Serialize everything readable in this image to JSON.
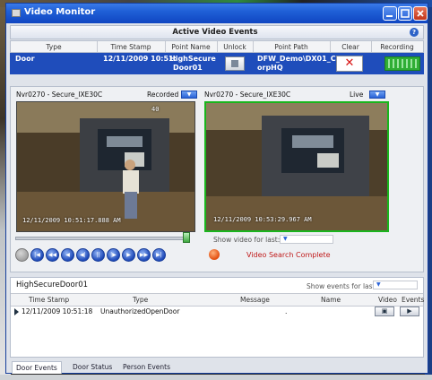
{
  "window": {
    "title": "Video Monitor"
  },
  "active_events": {
    "title": "Active Video Events",
    "columns": [
      "Type",
      "Time Stamp",
      "Point Name",
      "Unlock",
      "Point Path",
      "Clear",
      "Recording"
    ],
    "row": {
      "type": "Door",
      "time_stamp": "12/11/2009 10:51:",
      "point_name_1": "HighSecure",
      "point_name_2": "Door01",
      "point_path_1": "DFW_Demo\\DX01_C",
      "point_path_2": "orpHQ",
      "clear_glyph": "✕"
    }
  },
  "cameras": {
    "left": {
      "name": "Nvr0270 - Secure_IXE30C",
      "mode": "Recorded",
      "timestamp": "12/11/2009  10:51:17.888 AM",
      "frame_counter": "40"
    },
    "right": {
      "name": "Nvr0270 - Secure_IXE30C",
      "mode": "Live",
      "timestamp": "12/11/2009  10:53:29.967 AM"
    }
  },
  "playback": {
    "show_video_label": "Show video for last:",
    "status": "Video Search Complete",
    "position_fraction": 0.97
  },
  "events": {
    "title": "HighSecureDoor01",
    "show_events_label": "Show events for last:",
    "columns": [
      "Time Stamp",
      "Type",
      "Message",
      "Name",
      "Video",
      "Events"
    ],
    "rows": [
      {
        "time_stamp": "12/11/2009 10:51:18",
        "type": "UnauthorizedOpenDoor",
        "message": "",
        "name": "."
      }
    ]
  },
  "tabs": [
    "Door Events",
    "Door Status",
    "Person Events"
  ],
  "colors": {
    "title_bar": "#1f5fd6",
    "selected_row": "#1f4dbb",
    "recording": "#2fae34",
    "live_border": "#19b51d",
    "status_text": "#c01a1a"
  }
}
